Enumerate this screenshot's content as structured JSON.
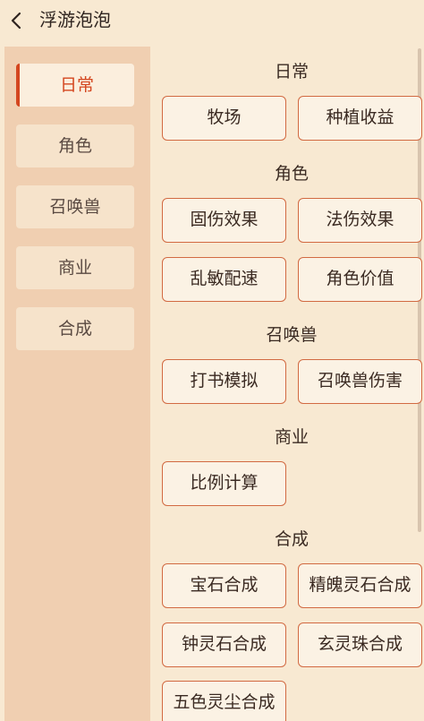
{
  "header": {
    "title": "浮游泡泡"
  },
  "sidebar": {
    "items": [
      {
        "label": "日常"
      },
      {
        "label": "角色"
      },
      {
        "label": "召唤兽"
      },
      {
        "label": "商业"
      },
      {
        "label": "合成"
      }
    ]
  },
  "sections": [
    {
      "title": "日常",
      "buttons": [
        "牧场",
        "种植收益"
      ]
    },
    {
      "title": "角色",
      "buttons": [
        "固伤效果",
        "法伤效果",
        "乱敏配速",
        "角色价值"
      ]
    },
    {
      "title": "召唤兽",
      "buttons": [
        "打书模拟",
        "召唤兽伤害"
      ]
    },
    {
      "title": "商业",
      "buttons": [
        "比例计算"
      ]
    },
    {
      "title": "合成",
      "buttons": [
        "宝石合成",
        "精魄灵石合成",
        "钟灵石合成",
        "玄灵珠合成",
        "五色灵尘合成"
      ]
    }
  ]
}
